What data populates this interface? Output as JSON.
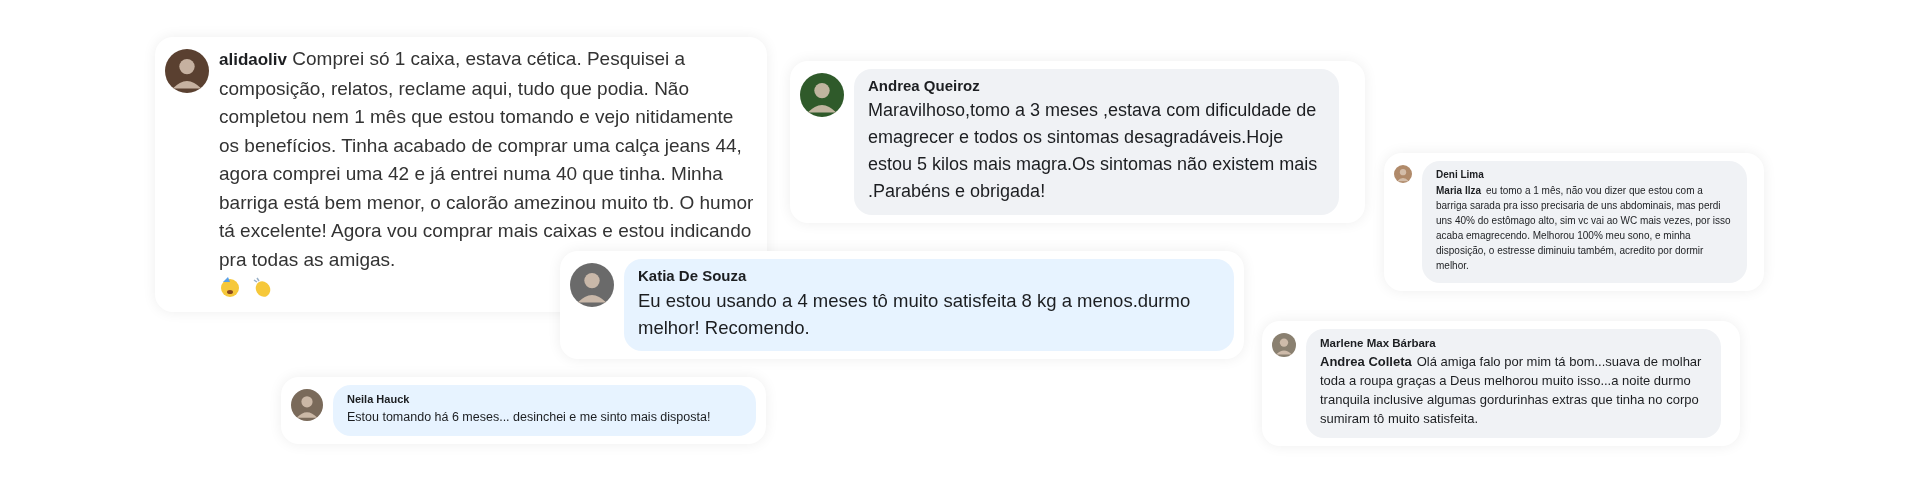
{
  "comments": [
    {
      "kind": "plain",
      "author": "alidaoliv",
      "text": "Comprei só 1 caixa, estava cética. Pesquisei a composição, relatos, reclame aqui, tudo que podia. Não completou nem 1 mês que estou tomando e vejo nitidamente os benefícios. Tinha acabado de comprar uma calça jeans 44, agora comprei uma 42 e já entrei numa 40 que tinha. Minha barriga está bem menor, o calorão amezinou muito tb. O humor tá excelente! Agora vou comprar mais caixas e estou indicando pra todas as amigas."
    },
    {
      "kind": "bubble",
      "color": "#f0f2f5",
      "author": "Andrea Queiroz",
      "text": "Maravilhoso,tomo a 3 meses ,estava com dificuldade de emagrecer e todos os sintomas desagradáveis.Hoje estou 5 kilos mais magra.Os sintomas não existem mais .Parabéns e obrigada!"
    },
    {
      "kind": "bubble",
      "color": "#f0f2f5",
      "author": "Deni Lima",
      "mention": "Maria Ilza",
      "text": "eu tomo a 1 mês, não vou dizer que estou com a barriga sarada pra isso precisaria de uns abdominais, mas perdi uns 40% do estômago alto, sim vc vai ao WC mais vezes, por isso acaba emagrecendo. Melhorou 100% meu sono, e minha disposição, o estresse diminuiu também, acredito por dormir melhor."
    },
    {
      "kind": "bubble",
      "color": "#e7f3ff",
      "author": "Katia De Souza",
      "text": "Eu estou usando a 4 meses tô muito satisfeita 8 kg a menos.durmo melhor! Recomendo."
    },
    {
      "kind": "bubble",
      "color": "#e7f3ff",
      "author": "Neila Hauck",
      "text": "Estou tomando há 6 meses... desinchei e me sinto mais disposta!"
    },
    {
      "kind": "bubble",
      "color": "#f0f2f5",
      "author": "Marlene Max Bárbara",
      "mention": "Andrea Colleta",
      "text": "Olá amiga falo por mim tá bom...suava de molhar toda a roupa graças a Deus melhorou muito isso...a noite durmo tranquila inclusive algumas gordurinhas extras que tinha no corpo sumiram tô muito satisfeita."
    }
  ]
}
